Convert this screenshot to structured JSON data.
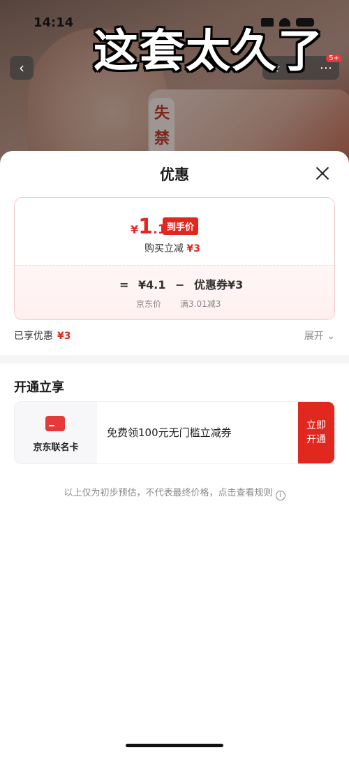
{
  "status": {
    "time": "14:14"
  },
  "caption": "这套太久了",
  "background": {
    "food_label": "失禁出",
    "more_badge": "5+"
  },
  "sheet": {
    "title": "优惠",
    "final_price": {
      "currency": "¥",
      "integer": "1",
      "decimal": ".1",
      "tag": "到手价"
    },
    "reduce": {
      "label": "购买立减",
      "amount": "¥3"
    },
    "formula": {
      "eq": "=",
      "base": "¥4.1",
      "minus": "−",
      "coupon": "优惠券¥3"
    },
    "base_label": "京东价",
    "coupon_rule": "满3.01减3",
    "enjoyed": {
      "label": "已享优惠",
      "amount": "¥3"
    },
    "expand_label": "展开"
  },
  "membership": {
    "section_title": "开通立享",
    "card_name": "京东联名卡",
    "offer_text": "免费领100元无门槛立减券",
    "button_label": "立即开通"
  },
  "disclaimer": "以上仅为初步预估，不代表最终价格，点击查看规则",
  "colors": {
    "accent": "#e0281e",
    "card_border": "#f3c8cb"
  },
  "icons": [
    "back-icon",
    "star-icon",
    "share-icon",
    "close-icon",
    "chevron-down-icon",
    "card-icon",
    "info-icon"
  ]
}
